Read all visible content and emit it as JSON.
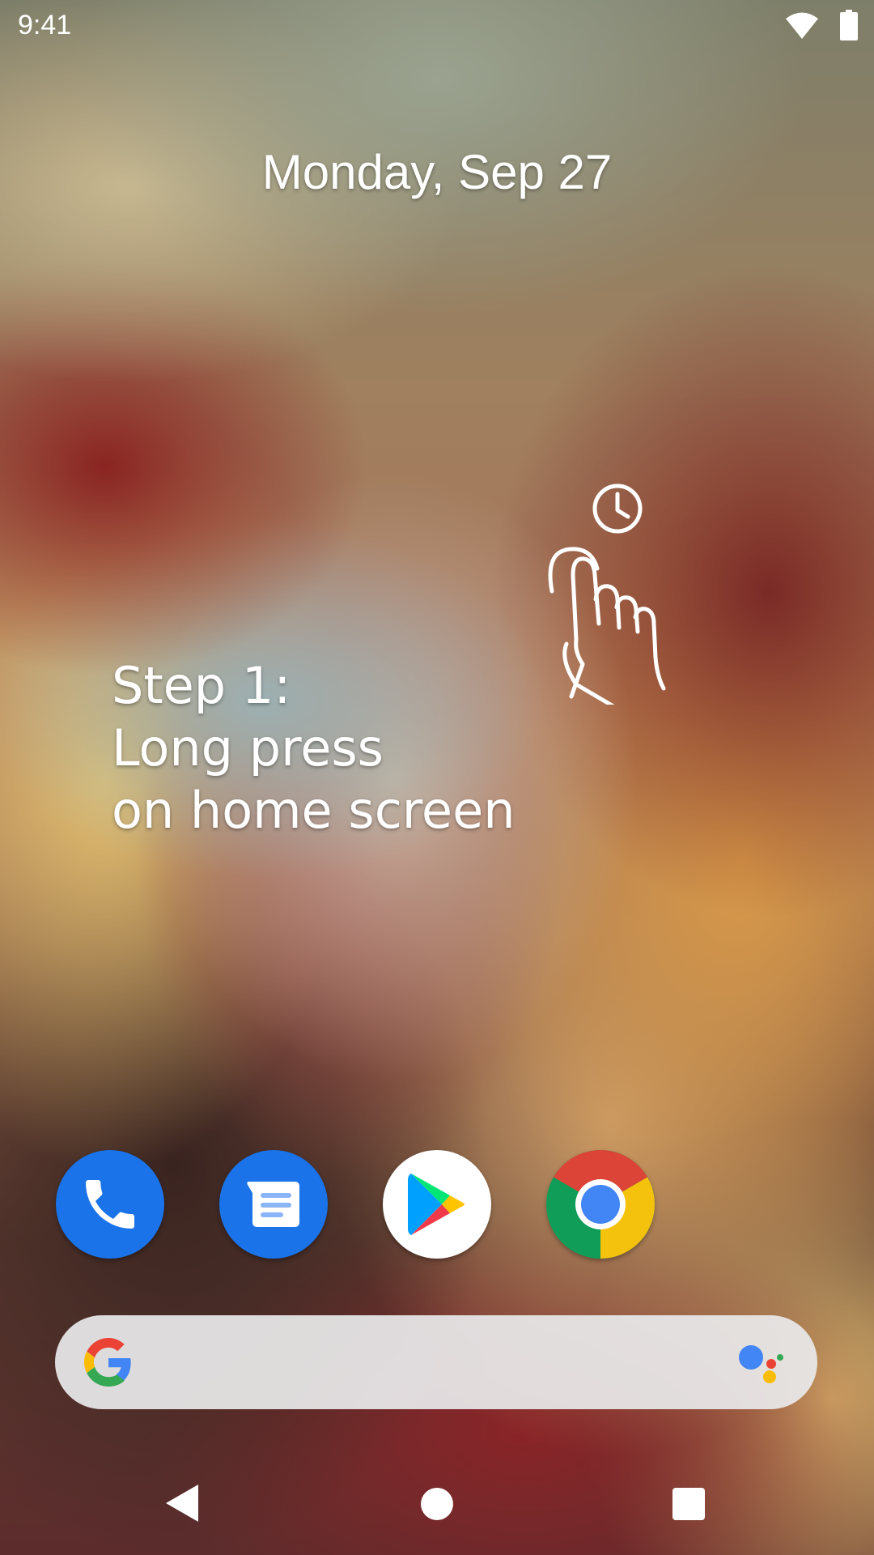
{
  "status_bar": {
    "time": "9:41",
    "icons": [
      "wifi-icon",
      "battery-icon"
    ]
  },
  "home": {
    "date": "Monday, Sep 27",
    "instruction": {
      "line1": "Step 1:",
      "line2": "Long press",
      "line3": "on home screen"
    },
    "gesture_icon": "long-press-hand-icon"
  },
  "dock": {
    "apps": [
      {
        "icon": "phone-icon",
        "color": "#1a73e8"
      },
      {
        "icon": "messages-icon",
        "color": "#1a73e8"
      },
      {
        "icon": "play-store-icon",
        "color": "#ffffff"
      },
      {
        "icon": "chrome-icon",
        "color": "#db4437"
      }
    ]
  },
  "search": {
    "left_icon": "google-g-icon",
    "right_icon": "google-assistant-icon",
    "bar_color": "#e8e8ea"
  },
  "nav_bar": {
    "buttons": [
      "back-button",
      "home-button",
      "recents-button"
    ]
  }
}
